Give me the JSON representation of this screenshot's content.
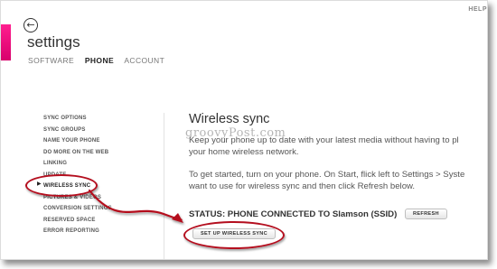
{
  "header": {
    "help_label": "HELP",
    "title": "settings",
    "tabs": [
      {
        "label": "SOFTWARE",
        "active": false
      },
      {
        "label": "PHONE",
        "active": true
      },
      {
        "label": "ACCOUNT",
        "active": false
      }
    ]
  },
  "sidebar": {
    "items": [
      {
        "label": "SYNC OPTIONS"
      },
      {
        "label": "SYNC GROUPS"
      },
      {
        "label": "NAME YOUR PHONE"
      },
      {
        "label": "DO MORE ON THE WEB"
      },
      {
        "label": "LINKING"
      },
      {
        "label": "UPDATE"
      },
      {
        "label": "WIRELESS SYNC",
        "selected": true
      },
      {
        "label": "PICTURES & VIDEOS"
      },
      {
        "label": "CONVERSION SETTINGS"
      },
      {
        "label": "RESERVED SPACE"
      },
      {
        "label": "ERROR REPORTING"
      }
    ]
  },
  "main": {
    "title": "Wireless sync",
    "watermark": "groovyPost.com",
    "paragraphs": [
      "Keep your phone up to date with your latest media without having to pl",
      "your home wireless network.",
      "To get started, turn on your phone. On Start, flick left to Settings > Syste",
      "want to use for wireless sync and then click Refresh below."
    ],
    "status": "STATUS: PHONE CONNECTED TO Slamson (SSID)",
    "refresh_label": "REFRESH",
    "setup_label": "SET UP WIRELESS SYNC"
  },
  "colors": {
    "accent": "#e8007f",
    "annotation": "#b40e1e"
  }
}
